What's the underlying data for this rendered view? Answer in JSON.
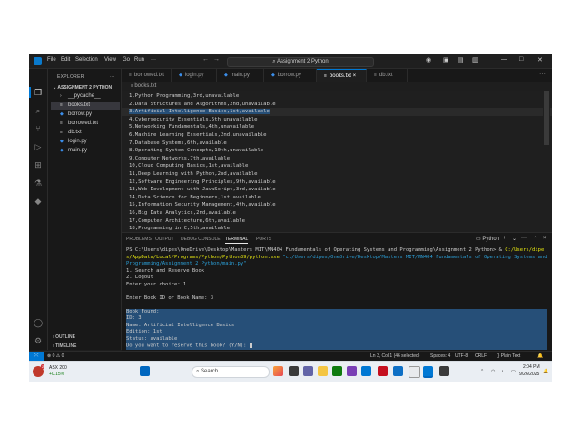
{
  "window": {
    "menu": [
      "File",
      "Edit",
      "Selection",
      "View",
      "Go",
      "Run"
    ],
    "search_text": "Assignment 2 Python",
    "win_controls": [
      "—",
      "□",
      "✕"
    ]
  },
  "explorer": {
    "title": "EXPLORER",
    "folder": "ASSIGNMENT 2 PYTHON",
    "items": [
      {
        "label": "__pycache__",
        "icon": "chevron-right"
      },
      {
        "label": "books.txt",
        "icon": "txt"
      },
      {
        "label": "borrow.py",
        "icon": "py"
      },
      {
        "label": "borrowed.txt",
        "icon": "txt"
      },
      {
        "label": "db.txt",
        "icon": "txt"
      },
      {
        "label": "login.py",
        "icon": "py"
      },
      {
        "label": "main.py",
        "icon": "py"
      }
    ],
    "outline": "OUTLINE",
    "timeline": "TIMELINE"
  },
  "tabs": [
    {
      "label": "borrowed.txt",
      "icon": "txt"
    },
    {
      "label": "login.py",
      "icon": "py"
    },
    {
      "label": "main.py",
      "icon": "py"
    },
    {
      "label": "borrow.py",
      "icon": "py"
    },
    {
      "label": "books.txt",
      "icon": "txt"
    },
    {
      "label": "db.txt",
      "icon": "txt"
    }
  ],
  "breadcrumb": "books.txt",
  "code_lines": [
    "1,Python Programming,3rd,unavailable",
    "2,Data Structures and Algorithms,2nd,unavailable",
    "3,Artificial Intelligence Basics,1st,available",
    "4,Cybersecurity Essentials,5th,unavailable",
    "5,Networking Fundamentals,4th,unavailable",
    "6,Machine Learning Essentials,2nd,unavailable",
    "7,Database Systems,6th,available",
    "8,Operating System Concepts,10th,unavailable",
    "9,Computer Networks,7th,available",
    "10,Cloud Computing Basics,1st,available",
    "11,Deep Learning with Python,2nd,available",
    "12,Software Engineering Principles,9th,available",
    "13,Web Development with JavaScript,3rd,available",
    "14,Data Science for Beginners,1st,available",
    "15,Information Security Management,4th,available",
    "16,Big Data Analytics,2nd,available",
    "17,Computer Architecture,6th,available",
    "18,Programming in C,5th,available"
  ],
  "panel": {
    "tabs": [
      "PROBLEMS",
      "OUTPUT",
      "DEBUG CONSOLE",
      "TERMINAL",
      "PORTS"
    ],
    "shell_label": "Python",
    "prompt": "PS C:\\Users\\dipes\\OneDrive\\Desktop\\Masters MIT\\MN404 Fundamentals of Operating Systems and Programming\\Assignment 2 Python> & ",
    "exe_path": "C:/Users/dipes/AppData/Local/Programs/Python/Python39/python.exe",
    "script_path": "\"c:/Users/dipes/OneDrive/Desktop/Masters MIT/MN404 Fundamentals of Operating Systems and Programming/Assignment 2 Python/main.py\"",
    "output": [
      "1. Search and Reserve Book",
      "2. Logout",
      "Enter your choice: 1",
      "",
      "Enter Book ID or Book Name: 3",
      "",
      "Book Found:",
      "ID: 3",
      "Name: Artificial Intelligence Basics",
      "Edition: 1st",
      "Status: available",
      "Do you want to reserve this book? (Y/N): "
    ]
  },
  "statusbar": {
    "problems": "⊗ 0 ⚠ 0",
    "position": "Ln 3, Col 1 (46 selected)",
    "spaces": "Spaces: 4",
    "encoding": "UTF-8",
    "eol": "CRLF",
    "language": "{} Plain Text"
  },
  "taskbar": {
    "weather_title": "ASX 200",
    "weather_value": "+0.15%",
    "weather_badge": "2",
    "search_placeholder": "Search",
    "time": "2:04 PM",
    "date": "9/26/2025"
  }
}
